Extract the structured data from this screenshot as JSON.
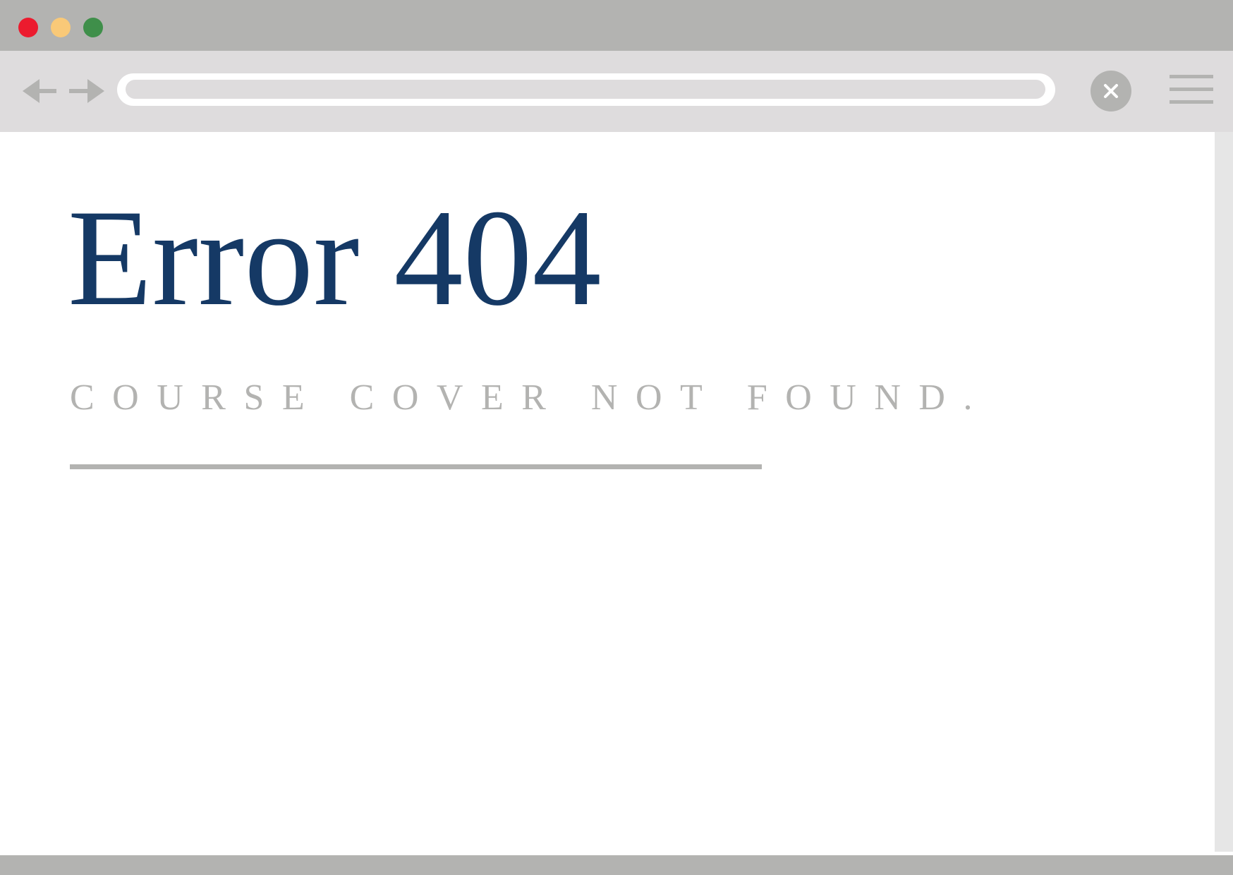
{
  "window": {
    "traffic_lights": [
      "close",
      "minimize",
      "maximize"
    ],
    "colors": {
      "close": "#ec1b2e",
      "minimize": "#f9c978",
      "maximize": "#3f8f4a",
      "chrome": "#b3b3b1",
      "toolbar": "#dedcdd"
    }
  },
  "toolbar": {
    "back_icon": "arrow-left-icon",
    "forward_icon": "arrow-right-icon",
    "address_value": "",
    "stop_icon": "close-icon",
    "menu_icon": "hamburger-menu-icon"
  },
  "page": {
    "title": "Error 404",
    "subtitle": "COURSE COVER NOT FOUND.",
    "title_color": "#153965",
    "subtitle_color": "#b3b3b1"
  }
}
